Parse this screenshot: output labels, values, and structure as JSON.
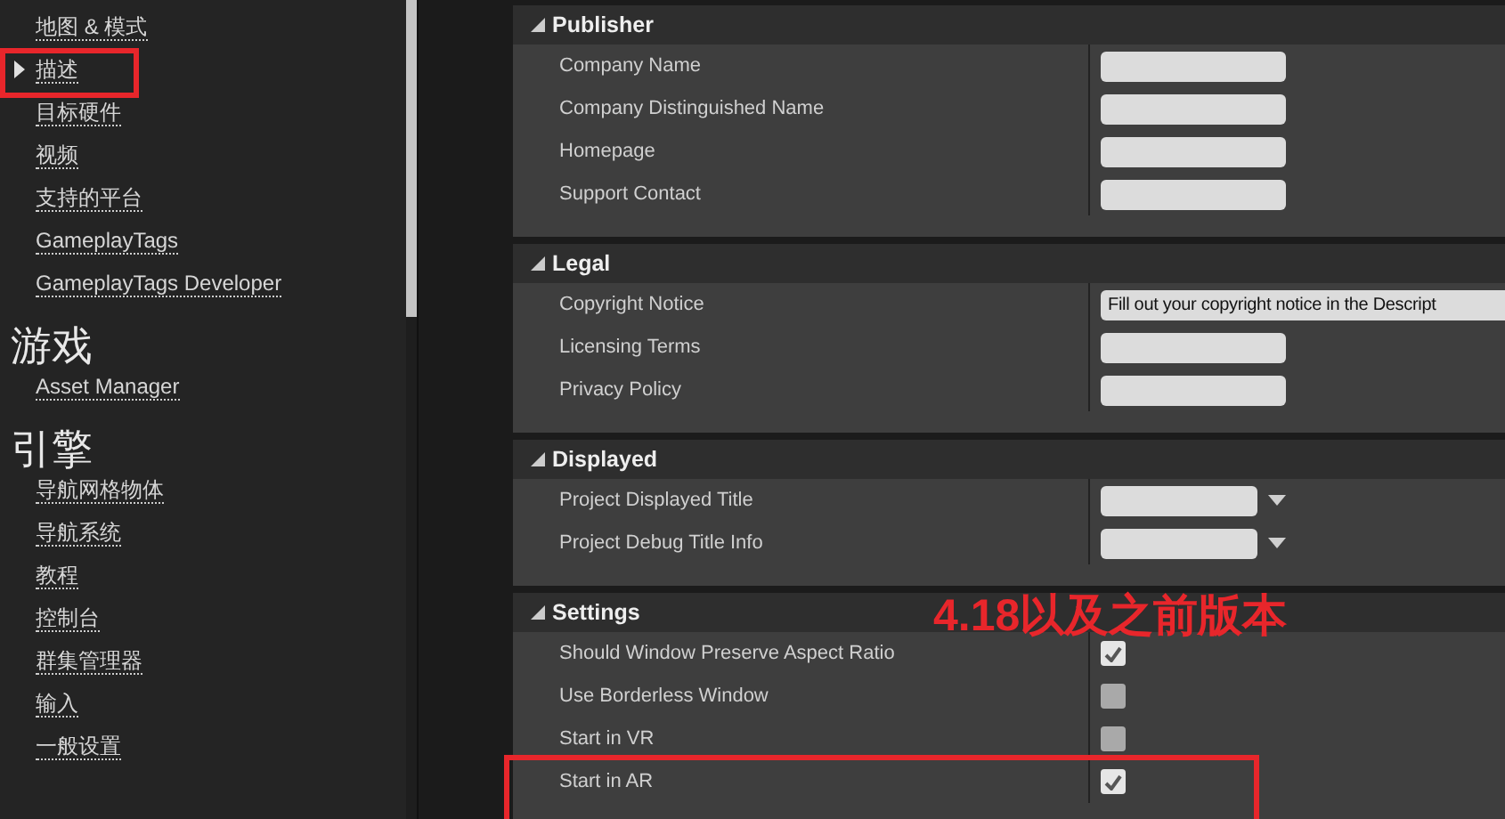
{
  "sidebar": {
    "groups": [
      {
        "items": [
          {
            "label": "地图 & 模式",
            "selected": false
          },
          {
            "label": "描述",
            "selected": true
          },
          {
            "label": "目标硬件",
            "selected": false
          },
          {
            "label": "视频",
            "selected": false
          },
          {
            "label": "支持的平台",
            "selected": false
          },
          {
            "label": "GameplayTags",
            "selected": false
          },
          {
            "label": "GameplayTags Developer",
            "selected": false
          }
        ]
      },
      {
        "heading": "游戏",
        "items": [
          {
            "label": "Asset Manager",
            "selected": false
          }
        ]
      },
      {
        "heading": "引擎",
        "items": [
          {
            "label": "导航网格物体",
            "selected": false
          },
          {
            "label": "导航系统",
            "selected": false
          },
          {
            "label": "教程",
            "selected": false
          },
          {
            "label": "控制台",
            "selected": false
          },
          {
            "label": "群集管理器",
            "selected": false
          },
          {
            "label": "输入",
            "selected": false
          },
          {
            "label": "一般设置",
            "selected": false
          }
        ]
      }
    ]
  },
  "sections": [
    {
      "title": "Publisher",
      "expanded": true,
      "rows": [
        {
          "label": "Company Name",
          "kind": "text"
        },
        {
          "label": "Company Distinguished Name",
          "kind": "text"
        },
        {
          "label": "Homepage",
          "kind": "text"
        },
        {
          "label": "Support Contact",
          "kind": "text"
        }
      ]
    },
    {
      "title": "Legal",
      "expanded": true,
      "rows": [
        {
          "label": "Copyright Notice",
          "kind": "text",
          "value": "Fill out your copyright notice in the Descript"
        },
        {
          "label": "Licensing Terms",
          "kind": "text"
        },
        {
          "label": "Privacy Policy",
          "kind": "text"
        }
      ]
    },
    {
      "title": "Displayed",
      "expanded": true,
      "rows": [
        {
          "label": "Project Displayed Title",
          "kind": "dropdown"
        },
        {
          "label": "Project Debug Title Info",
          "kind": "dropdown"
        }
      ]
    },
    {
      "title": "Settings",
      "expanded": true,
      "rows": [
        {
          "label": "Should Window Preserve Aspect Ratio",
          "kind": "checkbox",
          "checked": true
        },
        {
          "label": "Use Borderless Window",
          "kind": "checkbox",
          "checked": false
        },
        {
          "label": "Start in VR",
          "kind": "checkbox",
          "checked": false
        },
        {
          "label": "Start in AR",
          "kind": "checkbox",
          "checked": true
        }
      ]
    }
  ],
  "annotation": {
    "text": "4.18以及之前版本"
  }
}
